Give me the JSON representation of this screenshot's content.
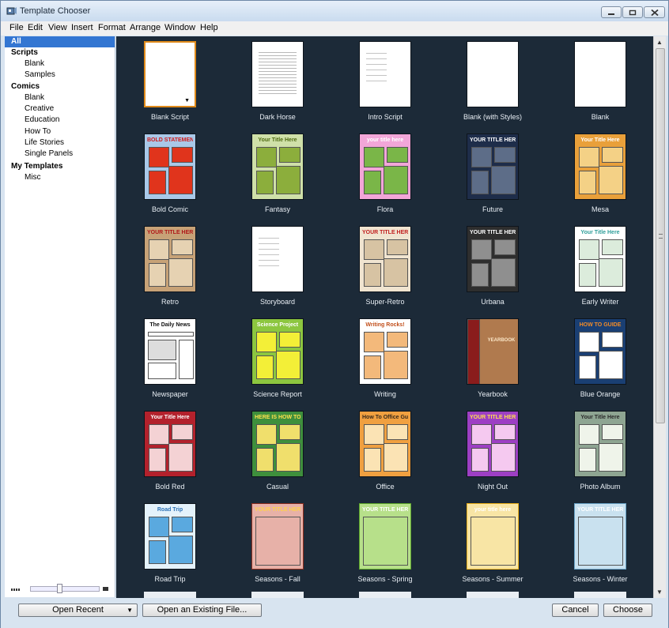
{
  "window": {
    "title": "Template Chooser",
    "controls": {
      "minimize": "minimize",
      "maximize": "maximize",
      "close": "close"
    }
  },
  "menu": [
    "File",
    "Edit",
    "View",
    "Insert",
    "Format",
    "Arrange",
    "Window",
    "Help"
  ],
  "sidebar": {
    "selected": "All",
    "items": [
      {
        "label": "All",
        "kind": "all"
      },
      {
        "label": "Scripts",
        "kind": "header"
      },
      {
        "label": "Blank",
        "kind": "sub"
      },
      {
        "label": "Samples",
        "kind": "sub"
      },
      {
        "label": "Comics",
        "kind": "header"
      },
      {
        "label": "Blank",
        "kind": "sub"
      },
      {
        "label": "Creative",
        "kind": "sub"
      },
      {
        "label": "Education",
        "kind": "sub"
      },
      {
        "label": "How To",
        "kind": "sub"
      },
      {
        "label": "Life Stories",
        "kind": "sub"
      },
      {
        "label": "Single Panels",
        "kind": "sub"
      },
      {
        "label": "My Templates",
        "kind": "header"
      },
      {
        "label": "Misc",
        "kind": "sub"
      }
    ]
  },
  "templates": [
    {
      "label": "Blank Script",
      "style": "blank",
      "selected": true,
      "bg": "#ffffff",
      "accent": "#ffffff"
    },
    {
      "label": "Dark Horse",
      "style": "text",
      "bg": "#ffffff",
      "accent": "#9a9a9a"
    },
    {
      "label": "Intro Script",
      "style": "sparse",
      "bg": "#ffffff",
      "accent": "#9a9a9a"
    },
    {
      "label": "Blank (with Styles)",
      "style": "plain",
      "bg": "#ffffff",
      "accent": "#ffffff"
    },
    {
      "label": "Blank",
      "style": "plain",
      "bg": "#ffffff",
      "accent": "#ffffff"
    },
    {
      "label": "Bold Comic",
      "style": "comic",
      "heading": "BOLD STATEMENTS",
      "bg": "#a9c8e8",
      "accent": "#e0341c",
      "text": "#d11a1a"
    },
    {
      "label": "Fantasy",
      "style": "comic",
      "heading": "Your Title Here",
      "bg": "#cfe0a8",
      "accent": "#8cae3c",
      "text": "#4f6b12"
    },
    {
      "label": "Flora",
      "style": "comic",
      "heading": "your title here",
      "bg": "#f2a6d8",
      "accent": "#7ab648",
      "text": "#ffffff"
    },
    {
      "label": "Future",
      "style": "comic",
      "heading": "YOUR TITLE HERE",
      "bg": "#1e2d4a",
      "accent": "#5d6d88",
      "text": "#ffffff"
    },
    {
      "label": "Mesa",
      "style": "comic",
      "heading": "Your Title Here",
      "bg": "#e9a03a",
      "accent": "#f4d186",
      "text": "#ffffff"
    },
    {
      "label": "Retro",
      "style": "comic",
      "heading": "YOUR TITLE HERE",
      "bg": "#c7a277",
      "accent": "#e6d2b2",
      "text": "#b01818"
    },
    {
      "label": "Storyboard",
      "style": "sparse",
      "bg": "#ffffff",
      "accent": "#9a9a9a"
    },
    {
      "label": "Super-Retro",
      "style": "comic",
      "heading": "YOUR TITLE HERE",
      "bg": "#f0e4d0",
      "accent": "#d7c3a3",
      "text": "#c22020"
    },
    {
      "label": "Urbana",
      "style": "comic",
      "heading": "YOUR TITLE HERE",
      "bg": "#2e2e2e",
      "accent": "#8f8f8f",
      "text": "#ffffff"
    },
    {
      "label": "Early Writer",
      "style": "comic",
      "heading": "Your Title Here",
      "bg": "#ffffff",
      "accent": "#dcecdc",
      "text": "#2f9e9a"
    },
    {
      "label": "Newspaper",
      "style": "news",
      "heading": "The Daily News",
      "bg": "#ffffff",
      "accent": "#aaaaaa",
      "text": "#111111"
    },
    {
      "label": "Science Report",
      "style": "comic",
      "heading": "Science Project",
      "bg": "#8cc63f",
      "accent": "#f3ef37",
      "text": "#ffffff"
    },
    {
      "label": "Writing",
      "style": "comic",
      "heading": "Writing Rocks!",
      "bg": "#ffffff",
      "accent": "#f3b97b",
      "text": "#c2501c"
    },
    {
      "label": "Yearbook",
      "style": "yearbook",
      "heading": "YEARBOOK TIME",
      "bg": "#b07a4e",
      "accent": "#8a1c1c",
      "text": "#fce7c7"
    },
    {
      "label": "Blue Orange",
      "style": "comic",
      "heading": "HOW TO GUIDE",
      "bg": "#1a3f73",
      "accent": "#ffffff",
      "text": "#f28c28"
    },
    {
      "label": "Bold Red",
      "style": "comic",
      "heading": "Your Title Here",
      "bg": "#b3212c",
      "accent": "#f4d2d4",
      "text": "#ffffff"
    },
    {
      "label": "Casual",
      "style": "comic",
      "heading": "HERE IS HOW TO",
      "bg": "#3e8f3c",
      "accent": "#f0df6c",
      "text": "#ffe14d"
    },
    {
      "label": "Office",
      "style": "comic",
      "heading": "How To Office Guide",
      "bg": "#f0a040",
      "accent": "#fbe3b4",
      "text": "#3a2a1a"
    },
    {
      "label": "Night Out",
      "style": "comic",
      "heading": "YOUR TITLE HERE",
      "bg": "#9d3fc4",
      "accent": "#f5c9f0",
      "text": "#ffe04f"
    },
    {
      "label": "Photo Album",
      "style": "comic",
      "heading": "Your Title Here",
      "bg": "#8ea592",
      "accent": "#eff4ea",
      "text": "#2a2a2a"
    },
    {
      "label": "Road Trip",
      "style": "comic",
      "heading": "Road Trip",
      "bg": "#e4f2fb",
      "accent": "#5aa9df",
      "text": "#2b70b5"
    },
    {
      "label": "Seasons - Fall",
      "style": "season",
      "heading": "YOUR TITLE HERE",
      "bg": "#e7b1a8",
      "accent": "#8b2d1e",
      "text": "#ffd24a"
    },
    {
      "label": "Seasons - Spring",
      "style": "season",
      "heading": "YOUR TITLE HERE",
      "bg": "#b7e08a",
      "accent": "#5ea82b",
      "text": "#ffffff"
    },
    {
      "label": "Seasons - Summer",
      "style": "season",
      "heading": "your title here",
      "bg": "#f8e5a5",
      "accent": "#f0b31a",
      "text": "#ffffff"
    },
    {
      "label": "Seasons - Winter",
      "style": "season",
      "heading": "YOUR TITLE HERE",
      "bg": "#c9e1ef",
      "accent": "#6aa4c8",
      "text": "#ffffff"
    }
  ],
  "footer": {
    "open_recent": "Open Recent",
    "open_existing": "Open an Existing File...",
    "cancel": "Cancel",
    "choose": "Choose"
  }
}
